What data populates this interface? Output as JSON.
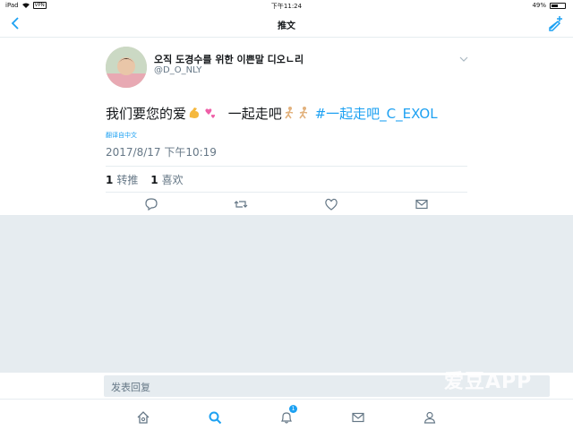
{
  "status": {
    "device": "iPad",
    "vpn": "VPN",
    "time": "下午11:24",
    "battery": "49%",
    "battery_level": 0.49
  },
  "nav": {
    "title": "推文",
    "back_icon": "chevron-left-icon",
    "compose_icon": "compose-tweet-icon"
  },
  "tweet": {
    "display_name": "오직 도경수를 위한 이쁜말 디오ㄴ리",
    "handle": "@D_O_NLY",
    "text_main": "我们要您的爱",
    "text_mid": "一起走吧",
    "hashtag": "#一起走吧_C_EXOL",
    "translate": "翻译自中文",
    "timestamp": "2017/8/17 下午10:19",
    "retweets_count": "1",
    "retweets_label": "转推",
    "likes_count": "1",
    "likes_label": "喜欢"
  },
  "reply": {
    "placeholder": "发表回复"
  },
  "tabs": {
    "notifications_badge": "1"
  },
  "watermark": {
    "brand": "爱豆APP"
  },
  "colors": {
    "accent": "#1da1f2",
    "panel": "#e6ecf0",
    "text_secondary": "#657786"
  }
}
